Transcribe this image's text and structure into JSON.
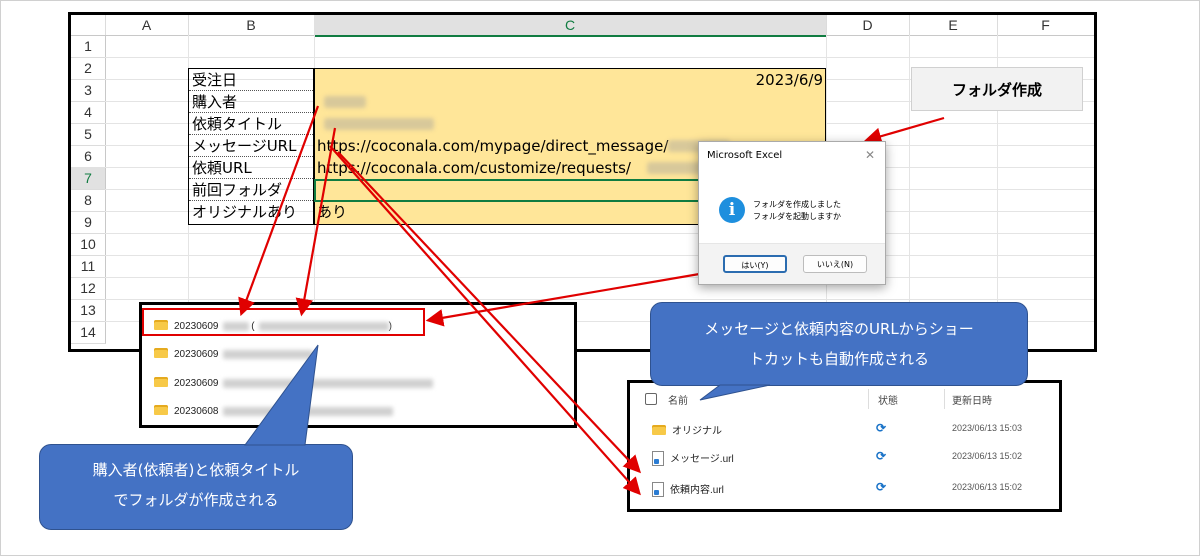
{
  "sheet": {
    "columns": [
      "A",
      "B",
      "C",
      "D",
      "E",
      "F"
    ],
    "rows": [
      "1",
      "2",
      "3",
      "4",
      "5",
      "6",
      "7",
      "8",
      "9",
      "10",
      "11",
      "12",
      "13",
      "14"
    ],
    "selected_column": "C",
    "selected_row": "7",
    "labels": [
      "受注日",
      "購入者",
      "依頼タイトル",
      "メッセージURL",
      "依頼URL",
      "前回フォルダ",
      "オリジナルあり"
    ],
    "values": {
      "date": "2023/6/9",
      "message_url": "https://coconala.com/mypage/direct_message/",
      "request_url": "https://coconala.com/customize/requests/",
      "original": "あり"
    },
    "button_label": "フォルダ作成"
  },
  "dialog": {
    "title": "Microsoft Excel",
    "close": "✕",
    "icon": "i",
    "message_line1": "フォルダを作成しました",
    "message_line2": "フォルダを起動しますか",
    "yes_label": "はい(Y)",
    "no_label": "いいえ(N)"
  },
  "folders": [
    {
      "prefix": "20230609",
      "sep": "(",
      "close": ")"
    },
    {
      "prefix": "20230609"
    },
    {
      "prefix": "20230609"
    },
    {
      "prefix": "20230608"
    }
  ],
  "explorer": {
    "headers": {
      "name": "名前",
      "status": "状態",
      "modified": "更新日時"
    },
    "files": [
      {
        "name": "オリジナル",
        "type": "folder",
        "date": "2023/06/13 15:03"
      },
      {
        "name": "メッセージ.url",
        "type": "url",
        "date": "2023/06/13 15:02"
      },
      {
        "name": "依頼内容.url",
        "type": "url",
        "date": "2023/06/13 15:02"
      }
    ]
  },
  "callouts": {
    "folder_line1": "購入者(依頼者)と依頼タイトル",
    "folder_line2": "でフォルダが作成される",
    "shortcut_line1": "メッセージと依頼内容のURLからショー",
    "shortcut_line2": "トカットも自動作成される"
  },
  "colors": {
    "highlight": "#ffe699",
    "arrow": "#e00000",
    "callout": "#4472c4",
    "excel_green": "#107c41"
  }
}
